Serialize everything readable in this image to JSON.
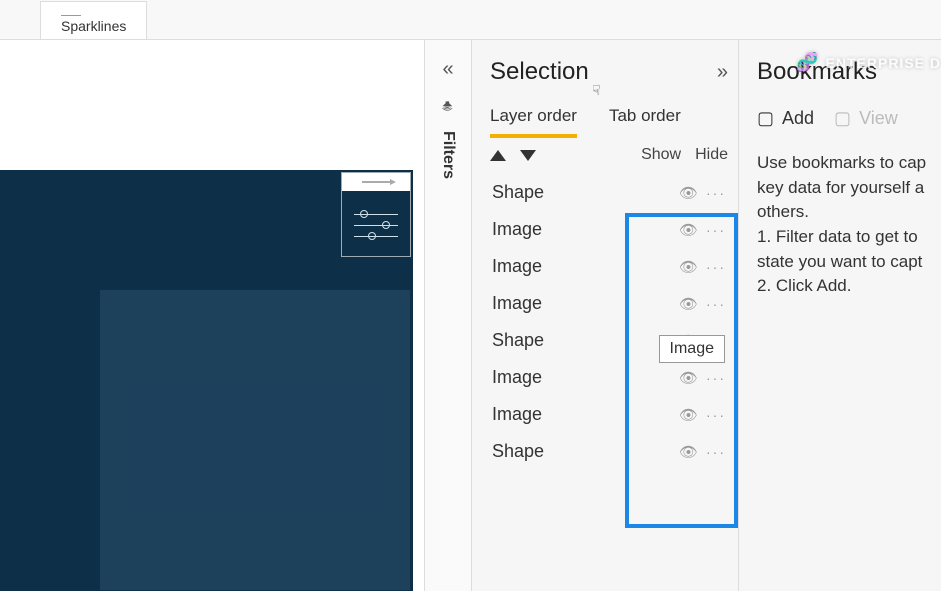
{
  "ribbon": {
    "tab_label": "Sparklines"
  },
  "filters": {
    "label": "Filters"
  },
  "selection": {
    "title": "Selection",
    "tabs": {
      "layer_order": "Layer order",
      "tab_order": "Tab order"
    },
    "columns": {
      "show": "Show",
      "hide": "Hide"
    },
    "items": [
      "Shape",
      "Image",
      "Image",
      "Image",
      "Shape",
      "Image",
      "Image",
      "Shape"
    ],
    "tooltip": "Image"
  },
  "bookmarks": {
    "title": "Bookmarks",
    "add": "Add",
    "view": "View",
    "help_line1": "Use bookmarks to cap",
    "help_line2": "key data for yourself a",
    "help_line3": "others.",
    "help_step1": "1. Filter data to get to",
    "help_step1b": "state you want to capt",
    "help_step2": "2. Click Add."
  },
  "watermark": {
    "text": "ENTERPRISE D"
  }
}
